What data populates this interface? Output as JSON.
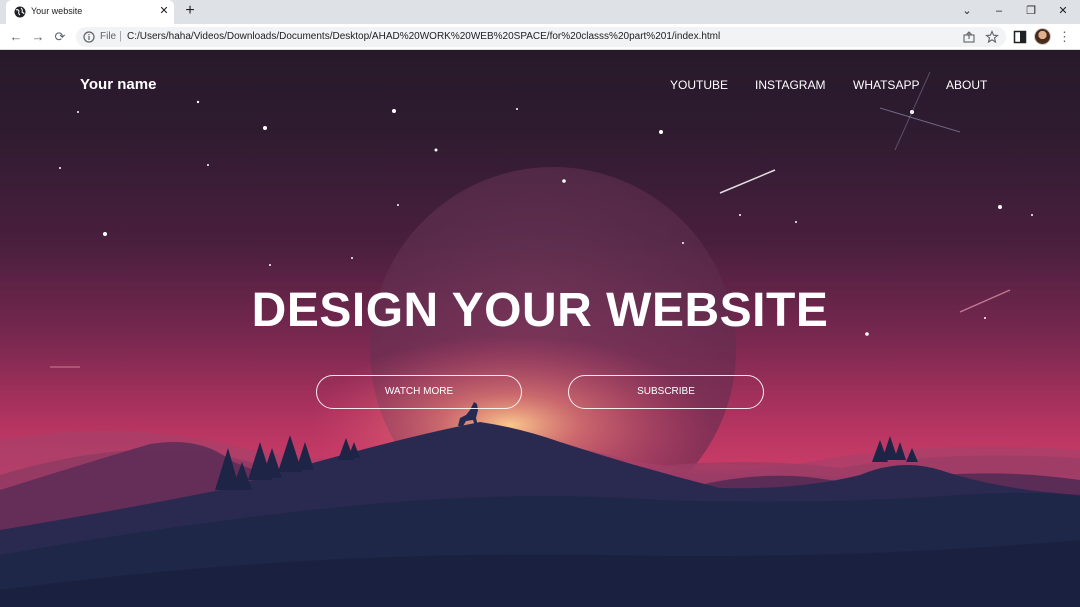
{
  "browser": {
    "tab_title": "Your website",
    "tab_close": "✕",
    "new_tab": "+",
    "window_controls": [
      "⌄",
      "–",
      "❐",
      "✕"
    ],
    "file_label": "File",
    "separator": "|",
    "url": "C:/Users/haha/Videos/Downloads/Documents/Desktop/AHAD%20WORK%20WEB%20SPACE/for%20classs%20part%201/index.html",
    "icons": [
      "globe-icon",
      "back-icon",
      "forward-icon",
      "reload-icon",
      "info-icon",
      "share-icon",
      "star-icon",
      "sidepanel-icon",
      "avatar",
      "menu-icon"
    ]
  },
  "site": {
    "logo": "Your name",
    "nav": [
      "YOUTUBE",
      "INSTAGRAM",
      "WHATSAPP",
      "ABOUT"
    ],
    "headline": "DESIGN YOUR WEBSITE",
    "buttons": {
      "watch_more": "WATCH MORE",
      "subscribe": "SUBSCRIBE"
    }
  },
  "colors": {
    "sky_top": "#27192a",
    "sky_bottom": "#e24a73",
    "mountain_front": "#1f2748",
    "moon": "#6a3a5a"
  }
}
